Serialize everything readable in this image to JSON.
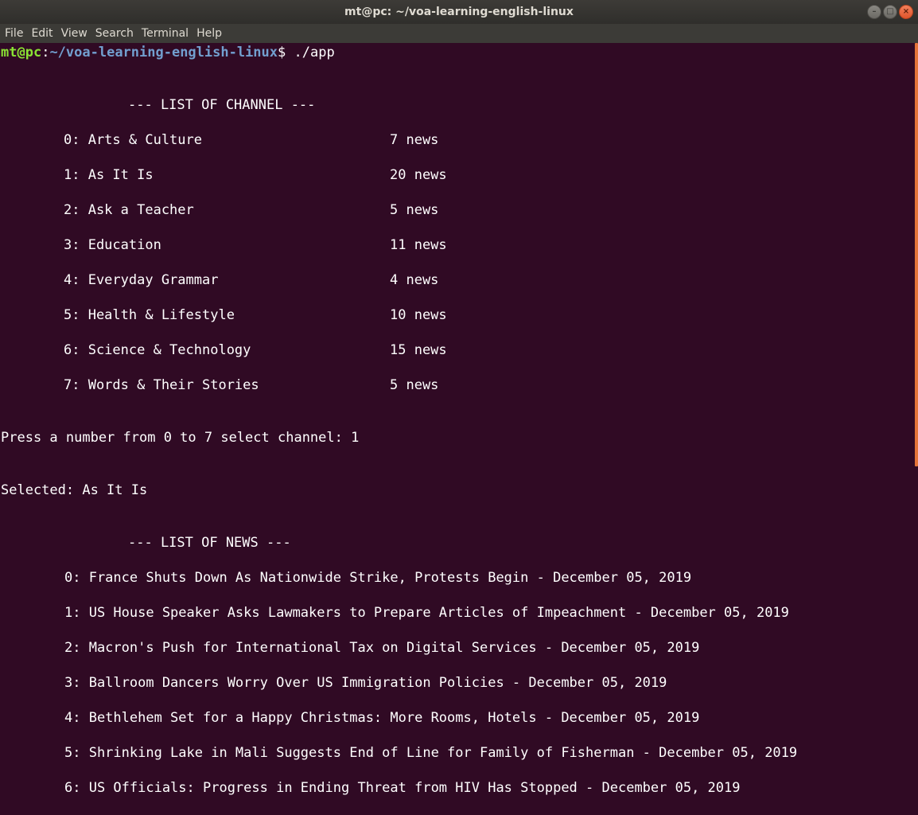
{
  "window": {
    "title": "mt@pc: ~/voa-learning-english-linux"
  },
  "menu": [
    "File",
    "Edit",
    "View",
    "Search",
    "Terminal",
    "Help"
  ],
  "prompt": {
    "user_host": "mt@pc",
    "colon": ":",
    "path": "~/voa-learning-english-linux",
    "symbol": "$ ",
    "command": "./app"
  },
  "channel_header": "--- LIST OF CHANNEL ---",
  "channels": [
    {
      "label": "0: Arts & Culture",
      "count": "7 news"
    },
    {
      "label": "1: As It Is",
      "count": "20 news"
    },
    {
      "label": "2: Ask a Teacher",
      "count": "5 news"
    },
    {
      "label": "3: Education",
      "count": "11 news"
    },
    {
      "label": "4: Everyday Grammar",
      "count": "4 news"
    },
    {
      "label": "5: Health & Lifestyle",
      "count": "10 news"
    },
    {
      "label": "6: Science & Technology",
      "count": "15 news"
    },
    {
      "label": "7: Words & Their Stories",
      "count": "5 news"
    }
  ],
  "select_prompt": "Press a number from 0 to 7 select channel: 1",
  "selected": "Selected: As It Is",
  "news_header": "--- LIST OF NEWS ---",
  "news": [
    "0: France Shuts Down As Nationwide Strike, Protests Begin - December 05, 2019",
    "1: US House Speaker Asks Lawmakers to Prepare Articles of Impeachment - December 05, 2019",
    "2: Macron's Push for International Tax on Digital Services - December 05, 2019",
    "3: Ballroom Dancers Worry Over US Immigration Policies - December 05, 2019",
    "4: Bethlehem Set for a Happy Christmas: More Rooms, Hotels - December 05, 2019",
    "5: Shrinking Lake in Mali Suggests End of Line for Family of Fisherman - December 05, 2019",
    "6: US Officials: Progress in Ending Threat from HIV Has Stopped - December 05, 2019"
  ],
  "colors": {
    "background": "#300a24",
    "prompt_user": "#8ae234",
    "prompt_path": "#729fcf",
    "scrollbar_thumb": "#e47439"
  }
}
